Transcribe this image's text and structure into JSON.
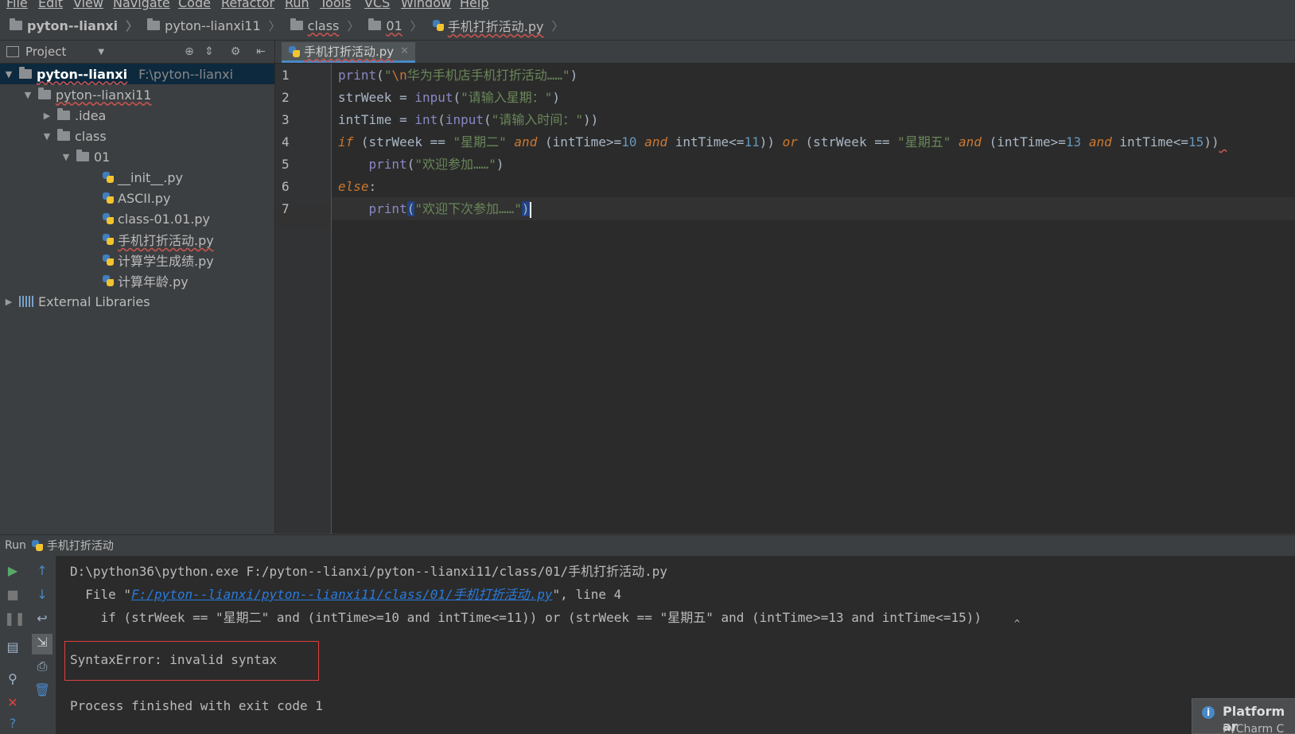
{
  "menu": [
    "File",
    "Edit",
    "View",
    "Navigate",
    "Code",
    "Refactor",
    "Run",
    "Tools",
    "VCS",
    "Window",
    "Help"
  ],
  "breadcrumb": [
    "pyton--lianxi",
    "pyton--lianxi11",
    "class",
    "01",
    "手机打折活动.py"
  ],
  "project": {
    "header": "Project",
    "root_label": "pyton--lianxi",
    "root_path": "F:\\pyton--lianxi",
    "items": [
      {
        "label": "pyton--lianxi11"
      },
      {
        "label": ".idea"
      },
      {
        "label": "class"
      },
      {
        "label": "01"
      },
      {
        "label": "__init__.py"
      },
      {
        "label": "ASCII.py"
      },
      {
        "label": "class-01.01.py"
      },
      {
        "label": "手机打折活动.py"
      },
      {
        "label": "计算学生成绩.py"
      },
      {
        "label": "计算年龄.py"
      }
    ],
    "external": "External Libraries"
  },
  "editor": {
    "tab": "手机打折活动.py",
    "line_numbers": [
      "1",
      "2",
      "3",
      "4",
      "5",
      "6",
      "7"
    ]
  },
  "run": {
    "title": "Run",
    "config": "手机打折活动",
    "cmd": "D:\\python36\\python.exe F:/pyton--lianxi/pyton--lianxi11/class/01/手机打折活动.py",
    "file_prefix": "  File \"",
    "file_link": "F:/pyton--lianxi/pyton--lianxi11/class/01/手机打折活动.py",
    "file_suffix": "\", line 4",
    "code_line": "    if (strWeek == \"星期二\" and (intTime>=10 and intTime<=11)) or (strWeek == \"星期五\" and (intTime>=13 and intTime<=15))",
    "caret": "^",
    "error": "SyntaxError: invalid syntax",
    "exit": "Process finished with exit code 1"
  },
  "notification": {
    "title": "Platform ar",
    "sub": "PyCharm C"
  }
}
